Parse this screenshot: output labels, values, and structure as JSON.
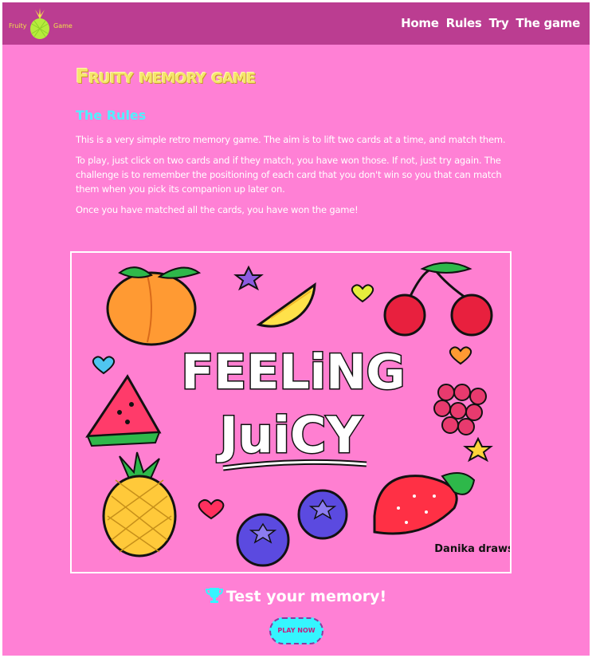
{
  "navbar": {
    "logo_left": "Fruity",
    "logo_right": "Game",
    "links": [
      "Home",
      "Rules",
      "Try",
      "The game"
    ]
  },
  "main": {
    "title": "Fruity memory game",
    "rules_heading": "The Rules",
    "paragraphs": [
      "This is a very simple retro memory game. The aim is to lift two cards at a time, and match them.",
      "To play, just click on two cards and if they match, you have won those. If not, just try again. The challenge is to remember the positioning of each card that you don't win so you that can match them when you pick its companion up later on.",
      "Once you have matched all the cards, you have won the game!"
    ],
    "hero_text_line1": "FEELiNG",
    "hero_text_line2": "JuiCY",
    "signature": "Danika draws",
    "cta": "Test your memory!",
    "play_button": "PLAY NOW"
  },
  "colors": {
    "page_bg": "#ff80d5",
    "navbar_bg": "#bb3d91",
    "heading_cyan": "#50f0ff",
    "title_yellow": "#f5e66a",
    "button_bg": "#35f5ff"
  },
  "icons": [
    "pineapple-logo-icon",
    "trophy-icon"
  ]
}
